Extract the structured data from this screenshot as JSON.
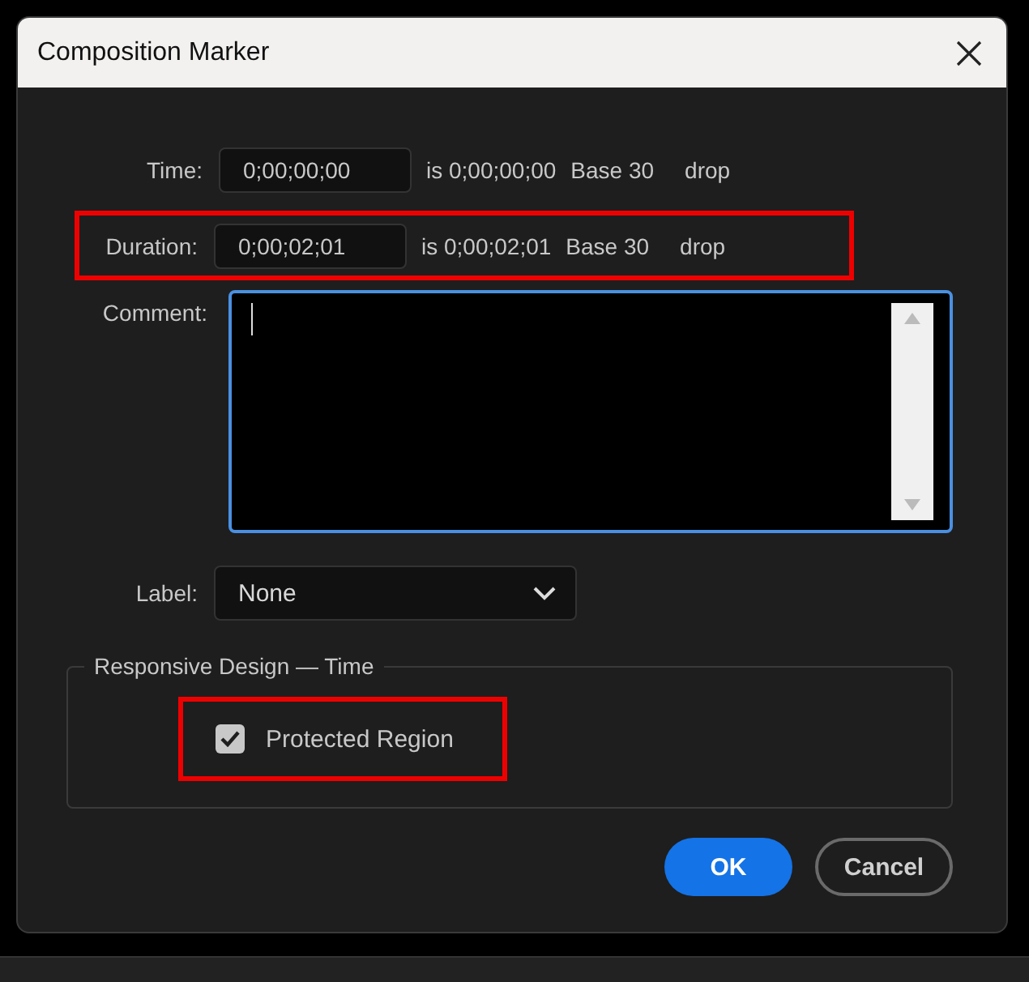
{
  "window": {
    "title": "Composition Marker"
  },
  "rows": [
    {
      "label": "Time:",
      "value": "0;00;00;00",
      "equals": "is 0;00;00;00",
      "base": "Base 30",
      "mode": "drop",
      "highlighted": false
    },
    {
      "label": "Duration:",
      "value": "0;00;02;01",
      "equals": "is 0;00;02;01",
      "base": "Base 30",
      "mode": "drop",
      "highlighted": true
    }
  ],
  "comment": {
    "label": "Comment:",
    "focused": true
  },
  "label_select": {
    "label": "Label:",
    "value": "None"
  },
  "responsive_group": {
    "title": "Responsive Design — Time",
    "checkbox": {
      "label": "Protected Region",
      "checked": true,
      "highlighted": true
    }
  },
  "buttons": [
    {
      "label": "OK",
      "kind": "primary"
    },
    {
      "label": "Cancel",
      "kind": "secondary"
    }
  ]
}
